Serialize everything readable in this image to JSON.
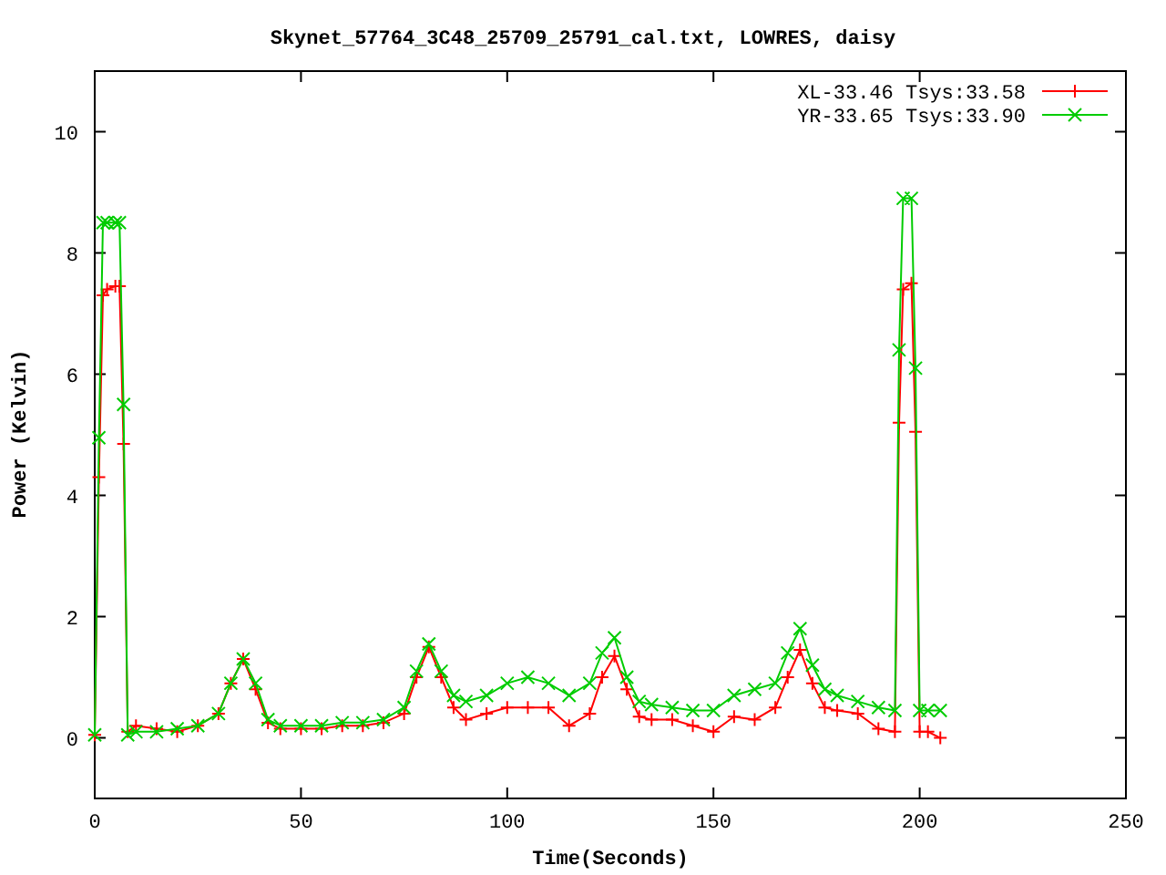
{
  "chart_data": {
    "type": "line",
    "title": "Skynet_57764_3C48_25709_25791_cal.txt, LOWRES, daisy",
    "xlabel": "Time(Seconds)",
    "ylabel": "Power (Kelvin)",
    "x": [
      0,
      1,
      2,
      3,
      5,
      6,
      7,
      8,
      10,
      15,
      20,
      25,
      30,
      33,
      36,
      39,
      42,
      45,
      50,
      55,
      60,
      65,
      70,
      75,
      78,
      81,
      84,
      87,
      90,
      95,
      100,
      105,
      110,
      115,
      120,
      123,
      126,
      129,
      132,
      135,
      140,
      145,
      150,
      155,
      160,
      165,
      168,
      171,
      174,
      177,
      180,
      185,
      190,
      194,
      195,
      196,
      198,
      199,
      200,
      202,
      205
    ],
    "series": [
      {
        "name": "XL-33.46 Tsys:33.58",
        "color": "#ff0000",
        "marker": "plus",
        "values": [
          0.05,
          4.3,
          7.3,
          7.4,
          7.45,
          7.45,
          4.85,
          0.1,
          0.2,
          0.15,
          0.1,
          0.2,
          0.4,
          0.9,
          1.3,
          0.8,
          0.25,
          0.15,
          0.15,
          0.15,
          0.2,
          0.2,
          0.25,
          0.4,
          1.0,
          1.5,
          1.0,
          0.5,
          0.3,
          0.4,
          0.5,
          0.5,
          0.5,
          0.2,
          0.4,
          1.0,
          1.35,
          0.8,
          0.35,
          0.3,
          0.3,
          0.2,
          0.1,
          0.35,
          0.3,
          0.5,
          1.0,
          1.45,
          0.9,
          0.5,
          0.45,
          0.4,
          0.15,
          0.1,
          5.2,
          7.4,
          7.5,
          5.05,
          0.1,
          0.1,
          0.0
        ]
      },
      {
        "name": "YR-33.65 Tsys:33.90",
        "color": "#00cc00",
        "marker": "cross",
        "values": [
          0.05,
          4.95,
          8.5,
          8.5,
          8.5,
          8.5,
          5.5,
          0.05,
          0.1,
          0.1,
          0.15,
          0.2,
          0.4,
          0.9,
          1.3,
          0.9,
          0.3,
          0.2,
          0.2,
          0.2,
          0.25,
          0.25,
          0.3,
          0.5,
          1.1,
          1.55,
          1.1,
          0.7,
          0.6,
          0.7,
          0.9,
          1.0,
          0.9,
          0.7,
          0.9,
          1.4,
          1.65,
          1.0,
          0.6,
          0.55,
          0.5,
          0.45,
          0.45,
          0.7,
          0.8,
          0.9,
          1.4,
          1.8,
          1.2,
          0.8,
          0.7,
          0.6,
          0.5,
          0.45,
          6.4,
          8.9,
          8.9,
          6.1,
          0.45,
          0.45,
          0.45
        ]
      }
    ],
    "legend": true,
    "xlim": [
      0,
      250
    ],
    "ylim": [
      -1,
      11
    ],
    "xticks": [
      0,
      50,
      100,
      150,
      200,
      250
    ],
    "yticks": [
      0,
      2,
      4,
      6,
      8,
      10
    ]
  }
}
